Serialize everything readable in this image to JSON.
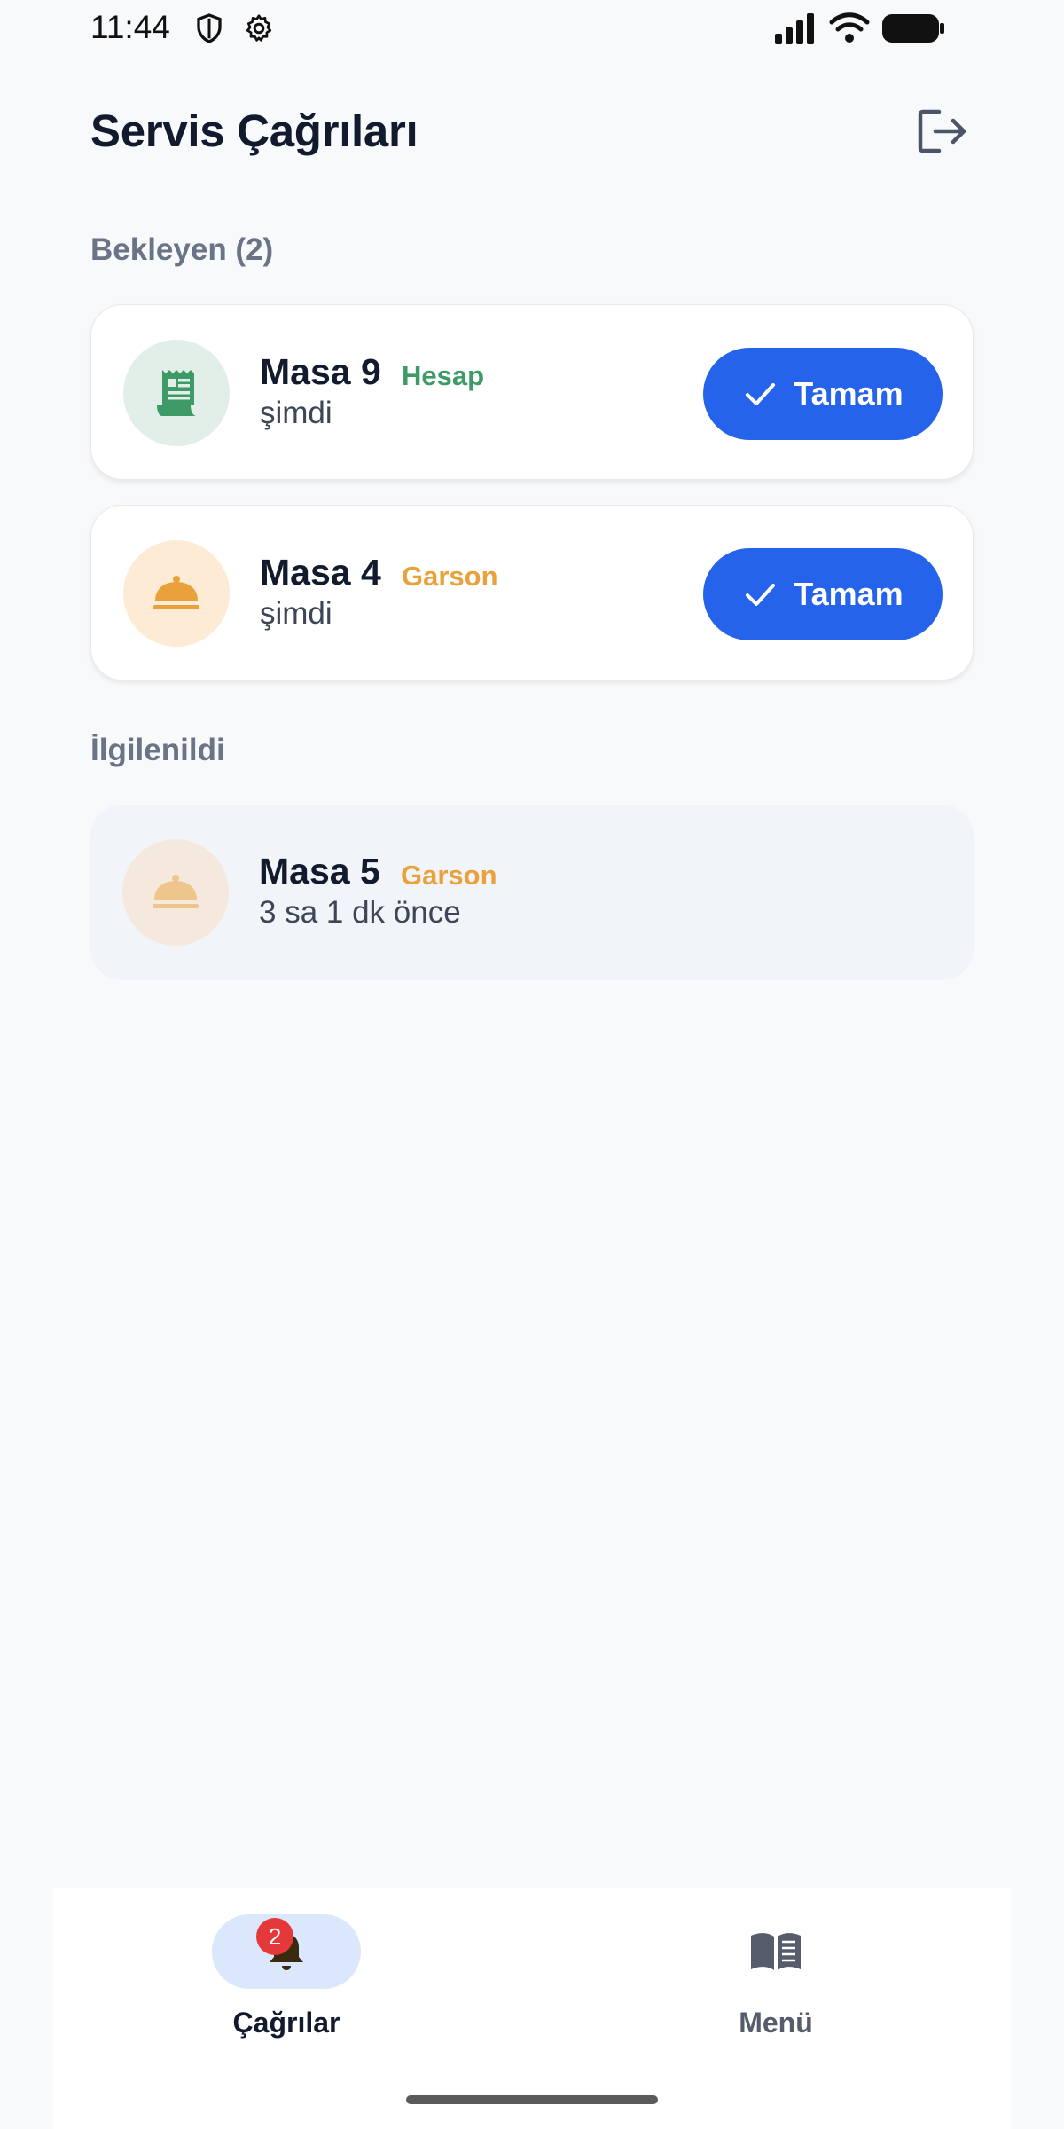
{
  "status_bar": {
    "time": "11:44"
  },
  "header": {
    "title": "Servis Çağrıları"
  },
  "sections": {
    "pending": {
      "title": "Bekleyen (2)",
      "cards": [
        {
          "table": "Masa 9",
          "type": "Hesap",
          "time": "şimdi",
          "action": "Tamam",
          "icon": "receipt-icon",
          "color": "#3e9a66"
        },
        {
          "table": "Masa 4",
          "type": "Garson",
          "time": "şimdi",
          "action": "Tamam",
          "icon": "service-bell-icon",
          "color": "#e9a23b"
        }
      ]
    },
    "handled": {
      "title": "İlgilenildi",
      "cards": [
        {
          "table": "Masa 5",
          "type": "Garson",
          "time": "3 sa 1 dk önce",
          "icon": "service-bell-icon",
          "color": "#e9a23b"
        }
      ]
    }
  },
  "bottom_nav": {
    "items": [
      {
        "label": "Çağrılar",
        "icon": "bell-icon",
        "badge": "2",
        "active": true
      },
      {
        "label": "Menü",
        "icon": "book-icon",
        "active": false
      }
    ]
  },
  "colors": {
    "accent": "#2563eb",
    "badge": "#e5383b",
    "green": "#3e9a66",
    "orange": "#e9a23b"
  }
}
